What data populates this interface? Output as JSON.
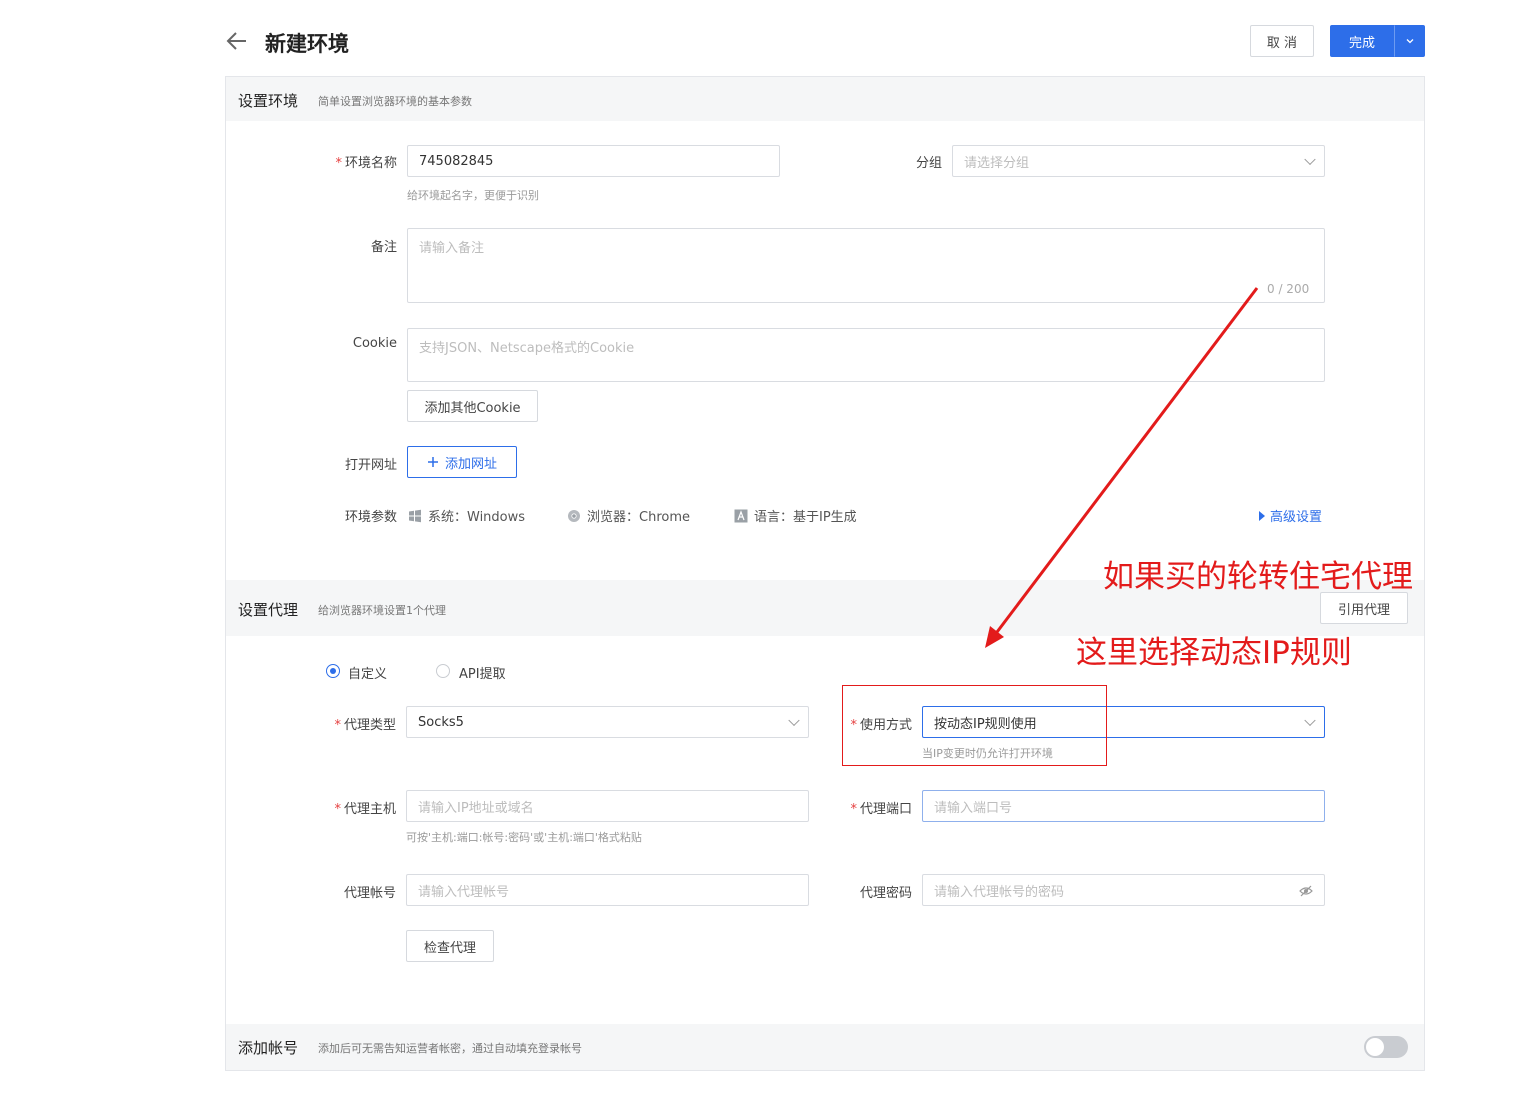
{
  "header": {
    "title": "新建环境",
    "cancel_label": "取 消",
    "done_label": "完成"
  },
  "section_env": {
    "title": "设置环境",
    "desc": "简单设置浏览器环境的基本参数",
    "env_name_label": "环境名称",
    "env_name_value": "745082845",
    "env_name_hint": "给环境起名字，更便于识别",
    "group_label": "分组",
    "group_placeholder": "请选择分组",
    "note_label": "备注",
    "note_placeholder": "请输入备注",
    "note_counter": "0 / 200",
    "cookie_label": "Cookie",
    "cookie_placeholder": "支持JSON、Netscape格式的Cookie",
    "add_cookie_label": "添加其他Cookie",
    "open_url_label": "打开网址",
    "add_url_label": "添加网址",
    "params_label": "环境参数",
    "param_system": "系统：Windows",
    "param_browser": "浏览器：Chrome",
    "param_language": "语言：基于IP生成",
    "advanced_label": "高级设置"
  },
  "section_proxy": {
    "title": "设置代理",
    "desc": "给浏览器环境设置1个代理",
    "ref_proxy_label": "引用代理",
    "radio_custom": "自定义",
    "radio_api": "API提取",
    "proxy_type_label": "代理类型",
    "proxy_type_value": "Socks5",
    "usage_label": "使用方式",
    "usage_value": "按动态IP规则使用",
    "usage_hint": "当IP变更时仍允许打开环境",
    "host_label": "代理主机",
    "host_placeholder": "请输入IP地址或域名",
    "host_hint": "可按'主机:端口:帐号:密码'或'主机:端口'格式粘贴",
    "port_label": "代理端口",
    "port_placeholder": "请输入端口号",
    "account_label": "代理帐号",
    "account_placeholder": "请输入代理帐号",
    "password_label": "代理密码",
    "password_placeholder": "请输入代理帐号的密码",
    "check_label": "检查代理"
  },
  "section_account": {
    "title": "添加帐号",
    "desc": "添加后可无需告知运营者帐密，通过自动填充登录帐号"
  },
  "annotation": {
    "line1": "如果买的轮转住宅代理",
    "line2": "这里选择动态IP规则"
  },
  "colors": {
    "primary": "#2d6ee9",
    "annotation": "#e31b1b"
  }
}
